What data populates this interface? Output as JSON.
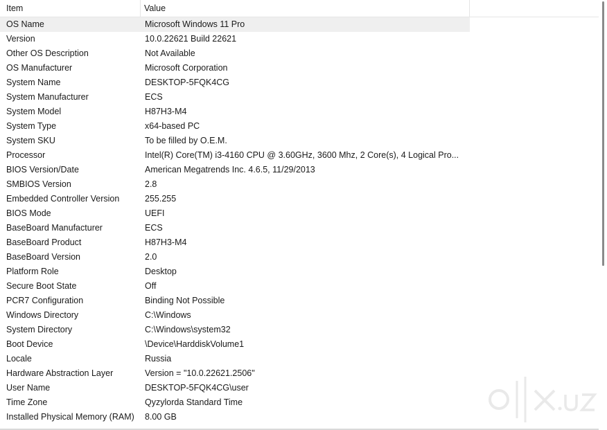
{
  "header": {
    "item_label": "Item",
    "value_label": "Value"
  },
  "rows": [
    {
      "item": "OS Name",
      "value": "Microsoft Windows 11 Pro"
    },
    {
      "item": "Version",
      "value": "10.0.22621 Build 22621"
    },
    {
      "item": "Other OS Description",
      "value": "Not Available"
    },
    {
      "item": "OS Manufacturer",
      "value": "Microsoft Corporation"
    },
    {
      "item": "System Name",
      "value": "DESKTOP-5FQK4CG"
    },
    {
      "item": "System Manufacturer",
      "value": "ECS"
    },
    {
      "item": "System Model",
      "value": "H87H3-M4"
    },
    {
      "item": "System Type",
      "value": "x64-based PC"
    },
    {
      "item": "System SKU",
      "value": "To be filled by O.E.M."
    },
    {
      "item": "Processor",
      "value": "Intel(R) Core(TM) i3-4160 CPU @ 3.60GHz, 3600 Mhz, 2 Core(s), 4 Logical Pro..."
    },
    {
      "item": "BIOS Version/Date",
      "value": "American Megatrends Inc. 4.6.5, 11/29/2013"
    },
    {
      "item": "SMBIOS Version",
      "value": "2.8"
    },
    {
      "item": "Embedded Controller Version",
      "value": "255.255"
    },
    {
      "item": "BIOS Mode",
      "value": "UEFI"
    },
    {
      "item": "BaseBoard Manufacturer",
      "value": "ECS"
    },
    {
      "item": "BaseBoard Product",
      "value": "H87H3-M4"
    },
    {
      "item": "BaseBoard Version",
      "value": "2.0"
    },
    {
      "item": "Platform Role",
      "value": "Desktop"
    },
    {
      "item": "Secure Boot State",
      "value": "Off"
    },
    {
      "item": "PCR7 Configuration",
      "value": "Binding Not Possible"
    },
    {
      "item": "Windows Directory",
      "value": "C:\\Windows"
    },
    {
      "item": "System Directory",
      "value": "C:\\Windows\\system32"
    },
    {
      "item": "Boot Device",
      "value": "\\Device\\HarddiskVolume1"
    },
    {
      "item": "Locale",
      "value": "Russia"
    },
    {
      "item": "Hardware Abstraction Layer",
      "value": "Version = \"10.0.22621.2506\""
    },
    {
      "item": "User Name",
      "value": "DESKTOP-5FQK4CG\\user"
    },
    {
      "item": "Time Zone",
      "value": "Qyzylorda Standard Time"
    },
    {
      "item": "Installed Physical Memory (RAM)",
      "value": "8.00 GB"
    }
  ],
  "selected_row": "OS Name",
  "watermark": {
    "text": "olx.uz",
    "icon": "olx-logo-icon"
  },
  "colors": {
    "selected_row_bg": "#efefef",
    "text": "#1a1a1a",
    "scroll_thumb": "#8a8a8a"
  }
}
